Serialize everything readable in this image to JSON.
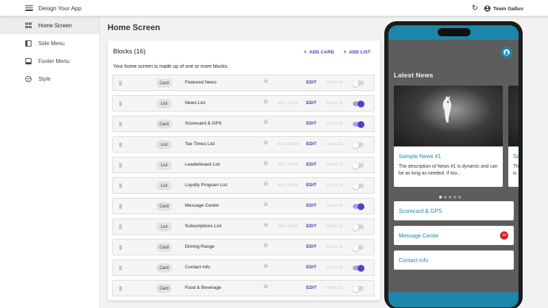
{
  "app": {
    "title": "Design Your App",
    "team_name": "Team Gallus"
  },
  "sidebar": {
    "items": [
      {
        "label": "Home Screen",
        "icon": "grid-icon",
        "active": true
      },
      {
        "label": "Side Menu",
        "icon": "side-menu-icon",
        "active": false
      },
      {
        "label": "Footer Menu",
        "icon": "footer-menu-icon",
        "active": false
      },
      {
        "label": "Style",
        "icon": "palette-icon",
        "active": false
      }
    ]
  },
  "main": {
    "page_title": "Home Screen",
    "blocks_title": "Blocks (16)",
    "add_card_label": "ADD CARD",
    "add_list_label": "ADD LIST",
    "description": "Your home screen is made up of one or more blocks.",
    "rows": [
      {
        "type": "Card",
        "name": "Featured News",
        "add_item": "",
        "edit": "EDIT",
        "delete": "DELETE",
        "enabled": false
      },
      {
        "type": "List",
        "name": "News List",
        "add_item": "ADD ITEM",
        "edit": "EDIT",
        "delete": "DELETE",
        "enabled": true
      },
      {
        "type": "Card",
        "name": "Scorecard & GPS",
        "add_item": "",
        "edit": "EDIT",
        "delete": "DELETE",
        "enabled": true
      },
      {
        "type": "List",
        "name": "Tee Times List",
        "add_item": "ADD ITEM",
        "edit": "EDIT",
        "delete": "DELETE",
        "enabled": false
      },
      {
        "type": "List",
        "name": "Leaderboard List",
        "add_item": "ADD ITEM",
        "edit": "EDIT",
        "delete": "DELETE",
        "enabled": false
      },
      {
        "type": "List",
        "name": "Loyalty Program List",
        "add_item": "ADD ITEM",
        "edit": "EDIT",
        "delete": "DELETE",
        "enabled": false
      },
      {
        "type": "Card",
        "name": "Message Center",
        "add_item": "",
        "edit": "EDIT",
        "delete": "DELETE",
        "enabled": true
      },
      {
        "type": "List",
        "name": "Subscriptions List",
        "add_item": "ADD ITEM",
        "edit": "EDIT",
        "delete": "DELETE",
        "enabled": false
      },
      {
        "type": "Card",
        "name": "Driving Range",
        "add_item": "",
        "edit": "EDIT",
        "delete": "DELETE",
        "enabled": false
      },
      {
        "type": "Card",
        "name": "Contact Info",
        "add_item": "",
        "edit": "EDIT",
        "delete": "DELETE",
        "enabled": true
      },
      {
        "type": "Card",
        "name": "Food & Beverage",
        "add_item": "",
        "edit": "EDIT",
        "delete": "DELETE",
        "enabled": false
      }
    ]
  },
  "phone": {
    "section_title": "Latest News",
    "news": [
      {
        "title": "Sample News #1",
        "description": "The description of News #1 is dynamic and can be as long as needed. If too..."
      },
      {
        "title": "Sa",
        "description": "Th\nis"
      }
    ],
    "carousel_dots": 5,
    "carousel_active": 0,
    "buttons": [
      {
        "label": "Scorecard & GPS",
        "badge": ""
      },
      {
        "label": "Message Center",
        "badge": "10"
      },
      {
        "label": "Contact Info",
        "badge": ""
      }
    ]
  },
  "colors": {
    "accent": "#3a34a8",
    "toggle_on": "#4b44c7",
    "phone_brand": "#1d86ab",
    "phone_bg": "#5d5d5d",
    "badge": "#d32222"
  }
}
